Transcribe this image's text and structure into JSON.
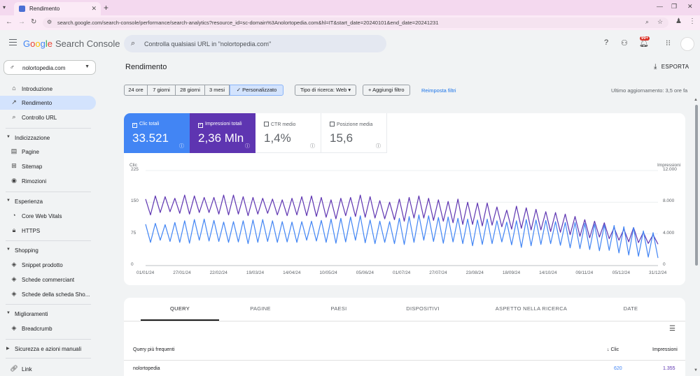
{
  "browser": {
    "tab_title": "Rendimento",
    "url": "search.google.com/search-console/performance/search-analytics?resource_id=sc-domain%3Anolortopedia.com&hl=IT&start_date=20240101&end_date=20241231"
  },
  "header": {
    "logo_google": [
      "G",
      "o",
      "o",
      "g",
      "l",
      "e"
    ],
    "logo_product": "Search Console",
    "search_placeholder": "Controlla qualsiasi URL in \"nolortopedia.com\"",
    "notification_count": "99+"
  },
  "sidebar": {
    "property": "nolortopedia.com",
    "items": [
      {
        "label": "Introduzione",
        "icon": "home-icon"
      },
      {
        "label": "Rendimento",
        "icon": "trending-icon"
      },
      {
        "label": "Controllo URL",
        "icon": "search-icon"
      }
    ],
    "sections": [
      {
        "label": "Indicizzazione",
        "items": [
          "Pagine",
          "Sitemap",
          "Rimozioni"
        ]
      },
      {
        "label": "Esperienza",
        "items": [
          "Core Web Vitals",
          "HTTPS"
        ]
      },
      {
        "label": "Shopping",
        "items": [
          "Snippet prodotto",
          "Schede commerciant",
          "Schede della scheda Sho..."
        ]
      },
      {
        "label": "Miglioramenti",
        "items": [
          "Breadcrumb"
        ]
      },
      {
        "label": "Sicurezza e azioni manuali",
        "items": []
      }
    ],
    "links_label": "Link"
  },
  "main": {
    "title": "Rendimento",
    "export_label": "ESPORTA",
    "date_ranges": [
      "24 ore",
      "7 giorni",
      "28 giorni",
      "3 mesi",
      "Personalizzato"
    ],
    "selected_range": "Personalizzato",
    "search_type": "Tipo di ricerca: Web",
    "add_filter": "Aggiungi filtro",
    "reset_filters": "Reimposta filtri",
    "last_update": "Ultimo aggiornamento: 3,5 ore fa"
  },
  "metrics": [
    {
      "label": "Clic totali",
      "value": "33.521",
      "active": true,
      "color": "#4285f4"
    },
    {
      "label": "Impressioni totali",
      "value": "2,36 Mln",
      "active": true,
      "color": "#5e35b1"
    },
    {
      "label": "CTR medio",
      "value": "1,4%",
      "active": false
    },
    {
      "label": "Posizione media",
      "value": "15,6",
      "active": false
    }
  ],
  "chart_data": {
    "type": "line",
    "y_left_label": "Clic",
    "y_right_label": "Impressioni",
    "y_left_ticks": [
      "225",
      "150",
      "75",
      "0"
    ],
    "y_right_ticks": [
      "12.000",
      "8.000",
      "4.000",
      "0"
    ],
    "ylim_left": [
      0,
      225
    ],
    "ylim_right": [
      0,
      12000
    ],
    "x_ticks": [
      "01/01/24",
      "27/01/24",
      "22/02/24",
      "19/03/24",
      "14/04/24",
      "10/05/24",
      "05/06/24",
      "01/07/24",
      "27/07/24",
      "23/08/24",
      "18/09/24",
      "14/10/24",
      "09/11/24",
      "05/12/24",
      "31/12/24"
    ],
    "series": [
      {
        "name": "Clic totali",
        "axis": "left",
        "color": "#4285f4",
        "weekly_high": [
          98,
          100,
          97,
          102,
          106,
          109,
          110,
          107,
          103,
          104,
          106,
          108,
          109,
          106,
          104,
          103,
          104,
          105,
          107,
          110,
          112,
          115,
          118,
          108,
          105,
          104,
          112,
          116,
          120,
          118,
          114,
          115,
          112,
          110,
          108,
          110,
          106,
          103,
          106,
          109,
          108,
          107,
          104,
          102,
          102,
          100,
          98,
          96,
          95,
          92,
          90,
          82,
          78
        ],
        "weekly_low": [
          55,
          60,
          57,
          55,
          53,
          60,
          58,
          57,
          55,
          56,
          52,
          55,
          57,
          55,
          56,
          55,
          60,
          58,
          55,
          53,
          56,
          60,
          54,
          52,
          55,
          52,
          50,
          55,
          60,
          57,
          53,
          56,
          52,
          47,
          50,
          52,
          56,
          49,
          43,
          47,
          50,
          52,
          48,
          42,
          40,
          38,
          35,
          36,
          30,
          25,
          22,
          20,
          18
        ]
      },
      {
        "name": "Impressioni totali",
        "axis": "right",
        "color": "#5e35b1",
        "weekly_high": [
          8400,
          8800,
          8700,
          8500,
          8900,
          8800,
          8600,
          8600,
          8900,
          8900,
          8700,
          8600,
          8500,
          8400,
          8300,
          8500,
          8700,
          8800,
          8600,
          8300,
          8500,
          8600,
          8900,
          8700,
          8200,
          8000,
          8400,
          8600,
          8800,
          8500,
          8300,
          8100,
          8400,
          8000,
          7900,
          7900,
          7400,
          7000,
          7500,
          7300,
          7100,
          6800,
          6700,
          6500,
          6200,
          5800,
          5600,
          5400,
          4800,
          4600,
          4800,
          4200,
          3900
        ],
        "weekly_low": [
          6400,
          6700,
          6800,
          6600,
          6500,
          6700,
          6700,
          6500,
          6400,
          6500,
          6300,
          6500,
          6600,
          6400,
          6300,
          6400,
          6300,
          6200,
          6100,
          5900,
          6300,
          6200,
          6100,
          6000,
          5900,
          5800,
          5600,
          6000,
          6000,
          5700,
          5600,
          5400,
          5200,
          5200,
          5000,
          5100,
          4900,
          4600,
          4700,
          4500,
          4500,
          4300,
          4200,
          3900,
          3700,
          3500,
          3600,
          3400,
          3200,
          3000,
          2900,
          2800,
          2700
        ]
      }
    ]
  },
  "table": {
    "tabs": [
      "QUERY",
      "PAGINE",
      "PAESI",
      "DISPOSITIVI",
      "ASPETTO NELLA RICERCA",
      "DATE"
    ],
    "active_tab": "QUERY",
    "columns": [
      "Query più frequenti",
      "Clic",
      "Impressioni"
    ],
    "rows": [
      {
        "query": "nolortopedia",
        "clicks": "620",
        "impressions": "1.355"
      }
    ]
  }
}
